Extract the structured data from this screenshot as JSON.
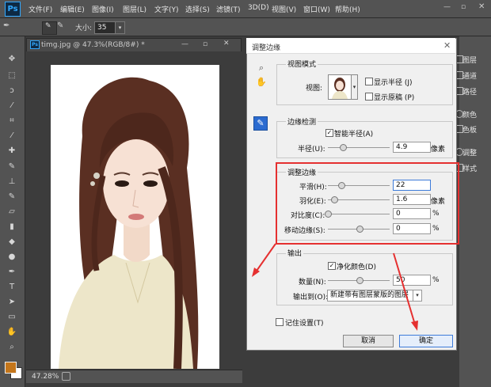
{
  "menubar": {
    "logo": "Ps",
    "items": [
      "文件(F)",
      "编辑(E)",
      "图像(I)",
      "图层(L)",
      "文字(Y)",
      "选择(S)",
      "滤镜(T)",
      "3D(D)",
      "视图(V)",
      "窗口(W)",
      "帮助(H)"
    ]
  },
  "options": {
    "size_label": "大小:",
    "size_value": "35"
  },
  "document": {
    "tab_title": "timg.jpg @ 47.3%(RGB/8#) *",
    "zoom": "47.28%"
  },
  "right_panels": [
    "图层",
    "通道",
    "路径",
    "颜色",
    "色板",
    "调整",
    "样式"
  ],
  "dialog": {
    "title": "调整边缘",
    "view_mode": {
      "group_label": "视图模式",
      "view_label": "视图:",
      "show_radius_label": "显示半径 (J)",
      "show_original_label": "显示原稿 (P)"
    },
    "edge_detection": {
      "group_label": "边缘检测",
      "smart_radius_label": "智能半径(A)",
      "radius_label": "半径(U):",
      "radius_value": "4.9",
      "radius_unit": "像素"
    },
    "adjust_edge": {
      "group_label": "调整边缘",
      "smooth_label": "平滑(H):",
      "smooth_value": "22",
      "feather_label": "羽化(E):",
      "feather_value": "1.6",
      "feather_unit": "像素",
      "contrast_label": "对比度(C):",
      "contrast_value": "0",
      "contrast_unit": "%",
      "shift_label": "移动边缘(S):",
      "shift_value": "0",
      "shift_unit": "%"
    },
    "output": {
      "group_label": "输出",
      "decontaminate_label": "净化颜色(D)",
      "amount_label": "数量(N):",
      "amount_value": "50",
      "amount_unit": "%",
      "output_to_label": "输出到(O):",
      "output_to_value": "新建带有图层蒙版的图层"
    },
    "remember_label": "记住设置(T)",
    "cancel_label": "取消",
    "ok_label": "确定"
  },
  "colors": {
    "accent_red": "#e53030",
    "foreground": "#c4761b",
    "background": "#ffffff"
  }
}
